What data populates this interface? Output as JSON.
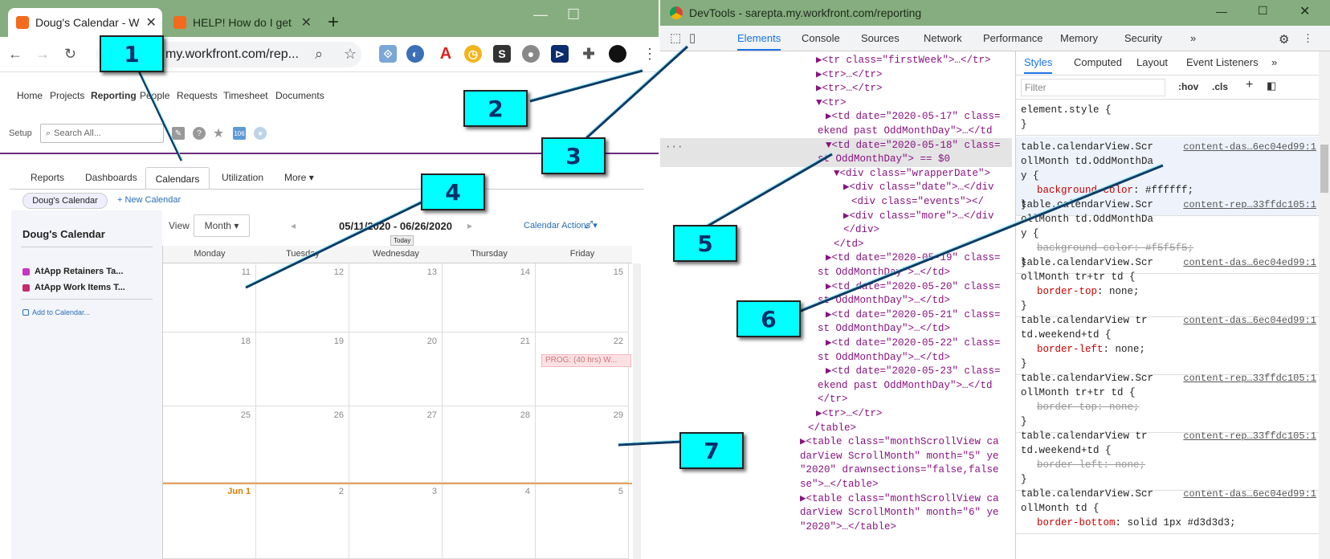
{
  "left_browser": {
    "tabs": [
      {
        "label": "Doug's Calendar - W"
      },
      {
        "label": "HELP! How do I get"
      }
    ],
    "new_tab": "+",
    "url": "my.workfront.com/rep...",
    "app_nav": [
      "Home",
      "Projects",
      "Reporting",
      "People",
      "Requests",
      "Timesheet",
      "Documents"
    ],
    "setup": "Setup",
    "search_placeholder": "Search All...",
    "badge": "106",
    "sub_tabs": [
      "Reports",
      "Dashboards",
      "Calendars",
      "Utilization",
      "More"
    ],
    "calendar_pill": "Doug's Calendar",
    "new_calendar": "+ New Calendar",
    "sidebar": {
      "title": "Doug's Calendar",
      "items": [
        {
          "label": "AtApp Retainers Ta...",
          "color": "#c833c8"
        },
        {
          "label": "AtApp Work Items T...",
          "color": "#c72a6e"
        }
      ],
      "add": "Add to Calendar..."
    },
    "view_label": "View",
    "view_mode": "Month",
    "date_range": "05/11/2020 - 06/26/2020",
    "today": "Today",
    "calendar_actions": "Calendar Actions",
    "weekdays": [
      "Monday",
      "Tuesday",
      "Wednesday",
      "Thursday",
      "Friday"
    ],
    "weeks": [
      [
        "11",
        "12",
        "13",
        "14",
        "15"
      ],
      [
        "18",
        "19",
        "20",
        "21",
        "22"
      ],
      [
        "25",
        "26",
        "27",
        "28",
        "29"
      ],
      [
        "Jun 1",
        "2",
        "3",
        "4",
        "5"
      ]
    ],
    "event": "PROG: (40 hrs) W..."
  },
  "devtools": {
    "title": "DevTools - sarepta.my.workfront.com/reporting",
    "tabs": [
      "Elements",
      "Console",
      "Sources",
      "Network",
      "Performance",
      "Memory",
      "Security"
    ],
    "dom_lines": [
      "▶<tr class=\"firstWeek\">…</tr>",
      "▶<tr>…</tr>",
      "▶<tr>…</tr>",
      "▼<tr>",
      "▶<td date=\"2020-05-17\" class=",
      "ekend past OddMonthDay\">…</td",
      "▼<td date=\"2020-05-18\" class=",
      "st OddMonthDay\"> == $0",
      "▼<div class=\"wrapperDate\">",
      "▶<div class=\"date\">…</div",
      "<div class=\"events\"></",
      "▶<div class=\"more\">…</div",
      "</div>",
      "</td>",
      "▶<td date=\"2020-05-19\" class=",
      "st OddMonthDay\">…</td>",
      "▶<td date=\"2020-05-20\" class=",
      "st OddMonthDay\">…</td>",
      "▶<td date=\"2020-05-21\" class=",
      "st OddMonthDay\">…</td>",
      "▶<td date=\"2020-05-22\" class=",
      "st OddMonthDay\">…</td>",
      "▶<td date=\"2020-05-23\" class=",
      "ekend past OddMonthDay\">…</td",
      "</tr>",
      "▶<tr>…</tr>",
      "</table>",
      "▶<table class=\"monthScrollView ca",
      "darView ScrollMonth\" month=\"5\" ye",
      "\"2020\" drawnsections=\"false,false",
      "se\">…</table>",
      "▶<table class=\"monthScrollView ca",
      "darView ScrollMonth\" month=\"6\" ye",
      "\"2020\">…</table>"
    ],
    "styles_tabs": [
      "Styles",
      "Computed",
      "Layout",
      "Event Listeners"
    ],
    "filter_placeholder": "Filter",
    "hov": ":hov",
    "cls": ".cls",
    "rules": [
      {
        "selector": "element.style {",
        "source": "",
        "props": [],
        "end": "}"
      },
      {
        "selector": "table.calendarView.ScrollMonth td.OddMonthDay {",
        "source": "content-das…6ec04ed99:1",
        "props": [
          {
            "name": "background-color",
            "value": "#ffffff",
            "struck": false
          }
        ],
        "end": "}"
      },
      {
        "selector": "table.calendarView.ScrollMonth td.OddMonthDay {",
        "source": "content-rep…33ffdc105:1",
        "props": [
          {
            "name": "background-color",
            "value": "#f5f5f5",
            "struck": true
          }
        ],
        "end": "}"
      },
      {
        "selector": "table.calendarView.ScrollMonth tr+tr td {",
        "source": "content-das…6ec04ed99:1",
        "props": [
          {
            "name": "border-top",
            "value": "none",
            "struck": false
          }
        ],
        "end": "}"
      },
      {
        "selector": "table.calendarView tr td.weekend+td {",
        "source": "content-das…6ec04ed99:1",
        "props": [
          {
            "name": "border-left",
            "value": "none",
            "struck": false
          }
        ],
        "end": "}"
      },
      {
        "selector": "table.calendarView.ScrollMonth tr+tr td {",
        "source": "content-rep…33ffdc105:1",
        "props": [
          {
            "name": "border-top",
            "value": "none",
            "struck": true
          }
        ],
        "end": "}"
      },
      {
        "selector": "table.calendarView tr td.weekend+td {",
        "source": "content-rep…33ffdc105:1",
        "props": [
          {
            "name": "border-left",
            "value": "none",
            "struck": true
          }
        ],
        "end": "}"
      },
      {
        "selector": "table.calendarView.ScrollMonth td {",
        "source": "content-das…6ec04ed99:1",
        "props": [
          {
            "name": "border-bottom",
            "value": "solid 1px #d3d3d3",
            "struck": false
          }
        ],
        "end": ""
      }
    ]
  },
  "callouts": [
    "1",
    "2",
    "3",
    "4",
    "5",
    "6",
    "7"
  ]
}
